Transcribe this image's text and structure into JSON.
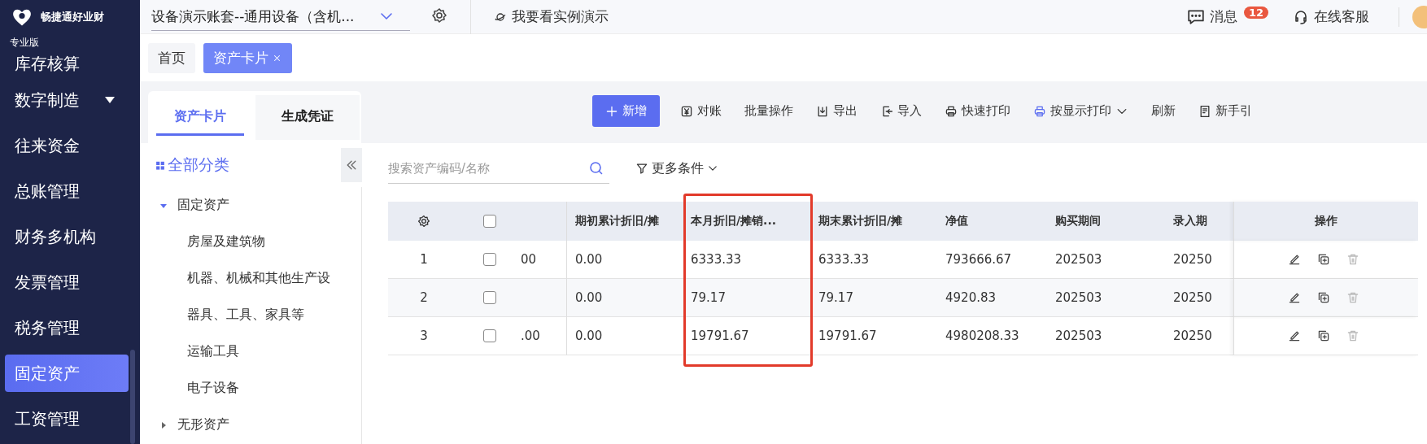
{
  "app": {
    "logo_text": "畅捷通好业财",
    "edition": "专业版"
  },
  "sidebar": {
    "items": [
      {
        "label": "库存核算",
        "selected": false,
        "kind": "link"
      },
      {
        "label": "数字制造",
        "selected": false,
        "kind": "group"
      },
      {
        "label": "往来资金",
        "selected": false,
        "kind": "link"
      },
      {
        "label": "总账管理",
        "selected": false,
        "kind": "link"
      },
      {
        "label": "财务多机构",
        "selected": false,
        "kind": "link"
      },
      {
        "label": "发票管理",
        "selected": false,
        "kind": "link"
      },
      {
        "label": "税务管理",
        "selected": false,
        "kind": "link"
      },
      {
        "label": "固定资产",
        "selected": true,
        "kind": "link"
      },
      {
        "label": "工资管理",
        "selected": false,
        "kind": "link"
      }
    ]
  },
  "topbar": {
    "account": "设备演示账套--通用设备（含机...",
    "demo_link": "我要看实例演示",
    "messages": {
      "label": "消息",
      "badge": "12"
    },
    "support": "在线客服"
  },
  "page_tabs": [
    {
      "label": "首页",
      "selected": false,
      "closable": false
    },
    {
      "label": "资产卡片",
      "selected": true,
      "closable": true
    }
  ],
  "card_tabs": [
    {
      "label": "资产卡片",
      "selected": true
    },
    {
      "label": "生成凭证",
      "selected": false
    }
  ],
  "toolbar": [
    {
      "label": "新增",
      "kind": "primary"
    },
    {
      "label": "对账",
      "kind": "plain"
    },
    {
      "label": "批量操作",
      "kind": "plain"
    },
    {
      "label": "导出",
      "kind": "plain"
    },
    {
      "label": "导入",
      "kind": "plain"
    },
    {
      "label": "快速打印",
      "kind": "plain"
    },
    {
      "label": "按显示打印",
      "kind": "dropdown"
    },
    {
      "label": "刷新",
      "kind": "plain"
    },
    {
      "label": "新手引",
      "kind": "plain"
    }
  ],
  "tree": {
    "title": "全部分类",
    "items": [
      {
        "label": "固定资产",
        "expanded": true,
        "children": [
          {
            "label": "房屋及建筑物"
          },
          {
            "label": "机器、机械和其他生产设"
          },
          {
            "label": "器具、工具、家具等"
          },
          {
            "label": "运输工具"
          },
          {
            "label": "电子设备"
          }
        ]
      },
      {
        "label": "无形资产",
        "expanded": false
      }
    ]
  },
  "search": {
    "placeholder": "搜索资产编码/名称"
  },
  "filter": {
    "label": "更多条件"
  },
  "table": {
    "columns": [
      {
        "label": "期初累计折旧/摊",
        "highlighted": false
      },
      {
        "label": "本月折旧/摊销...",
        "highlighted": true
      },
      {
        "label": "期末累计折旧/摊",
        "highlighted": false
      },
      {
        "label": "净值",
        "highlighted": false
      },
      {
        "label": "购买期间",
        "highlighted": false
      },
      {
        "label": "录入期",
        "highlighted": false
      }
    ],
    "actions_label": "操作",
    "all_checked": false,
    "rows": [
      {
        "index": "1",
        "checked": false,
        "cut_cell": "00",
        "cells": [
          "0.00",
          "6333.33",
          "6333.33",
          "793666.67",
          "202503",
          "20250"
        ]
      },
      {
        "index": "2",
        "checked": false,
        "cut_cell": null,
        "cells": [
          "0.00",
          "79.17",
          "79.17",
          "4920.83",
          "202503",
          "20250"
        ]
      },
      {
        "index": "3",
        "checked": false,
        "cut_cell": ".00",
        "cells": [
          "0.00",
          "19791.67",
          "19791.67",
          "4980208.33",
          "202503",
          "20250"
        ]
      }
    ]
  }
}
